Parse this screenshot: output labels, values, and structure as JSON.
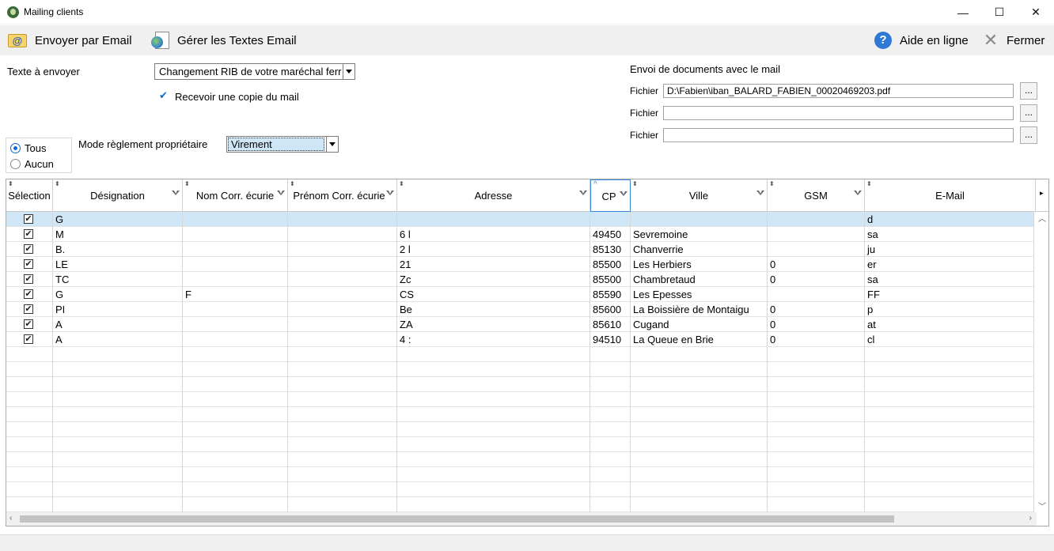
{
  "window": {
    "title": "Mailing clients",
    "minimize": "—",
    "maximize": "☐",
    "close": "✕"
  },
  "toolbar": {
    "send_email": "Envoyer par Email",
    "manage_texts": "Gérer les Textes Email",
    "help": "Aide en ligne",
    "close": "Fermer"
  },
  "form": {
    "text_label": "Texte à envoyer",
    "text_value": "Changement RIB de votre maréchal ferr",
    "copy_label": "Recevoir une copie du mail",
    "copy_checked": true,
    "mode_label": "Mode règlement propriétaire",
    "mode_value": "Virement",
    "radio_all": "Tous",
    "radio_none": "Aucun",
    "radio_selected": "Tous"
  },
  "documents": {
    "title": "Envoi de documents avec le mail",
    "files": [
      {
        "label": "Fichier",
        "value": "D:\\Fabien\\iban_BALARD_FABIEN_00020469203.pdf",
        "browse": "..."
      },
      {
        "label": "Fichier",
        "value": "",
        "browse": "..."
      },
      {
        "label": "Fichier",
        "value": "",
        "browse": "..."
      }
    ]
  },
  "table": {
    "columns": [
      "Sélection",
      "Désignation",
      "Nom Corr. écurie",
      "Prénom Corr. écurie",
      "Adresse",
      "CP",
      "Ville",
      "GSM",
      "E-Mail"
    ],
    "sorted_column": "CP",
    "rows": [
      {
        "selected": true,
        "designation": "G",
        "nom": "",
        "prenom": "",
        "adresse": "",
        "cp": "",
        "ville": "",
        "gsm": "",
        "email": "d",
        "highlight": true
      },
      {
        "selected": true,
        "designation": "M",
        "nom": "",
        "prenom": "",
        "adresse": "6 l",
        "cp": "49450",
        "ville": "Sevremoine",
        "gsm": "",
        "email": "sa"
      },
      {
        "selected": true,
        "designation": "B.",
        "nom": "",
        "prenom": "",
        "adresse": "2 l",
        "cp": "85130",
        "ville": "Chanverrie",
        "gsm": "",
        "email": "ju"
      },
      {
        "selected": true,
        "designation": "LE",
        "nom": "",
        "prenom": "",
        "adresse": "21",
        "cp": "85500",
        "ville": "Les Herbiers",
        "gsm": "0",
        "email": "er"
      },
      {
        "selected": true,
        "designation": "TC",
        "nom": "",
        "prenom": "",
        "adresse": "Zc",
        "cp": "85500",
        "ville": "Chambretaud",
        "gsm": "0",
        "email": "sa"
      },
      {
        "selected": true,
        "designation": "G",
        "nom": "F",
        "prenom": "",
        "adresse": "CS",
        "cp": "85590",
        "ville": "Les Epesses",
        "gsm": "",
        "email": "FF"
      },
      {
        "selected": true,
        "designation": "PI",
        "nom": "",
        "prenom": "",
        "adresse": "Be",
        "cp": "85600",
        "ville": "La Boissière de Montaigu",
        "gsm": "0",
        "email": "p"
      },
      {
        "selected": true,
        "designation": "A",
        "nom": "",
        "prenom": "",
        "adresse": "ZA",
        "cp": "85610",
        "ville": "Cugand",
        "gsm": "0",
        "email": "at"
      },
      {
        "selected": true,
        "designation": "A",
        "nom": "",
        "prenom": "",
        "adresse": "4 :",
        "cp": "94510",
        "ville": "La Queue en Brie",
        "gsm": "0",
        "email": "cl"
      }
    ]
  }
}
